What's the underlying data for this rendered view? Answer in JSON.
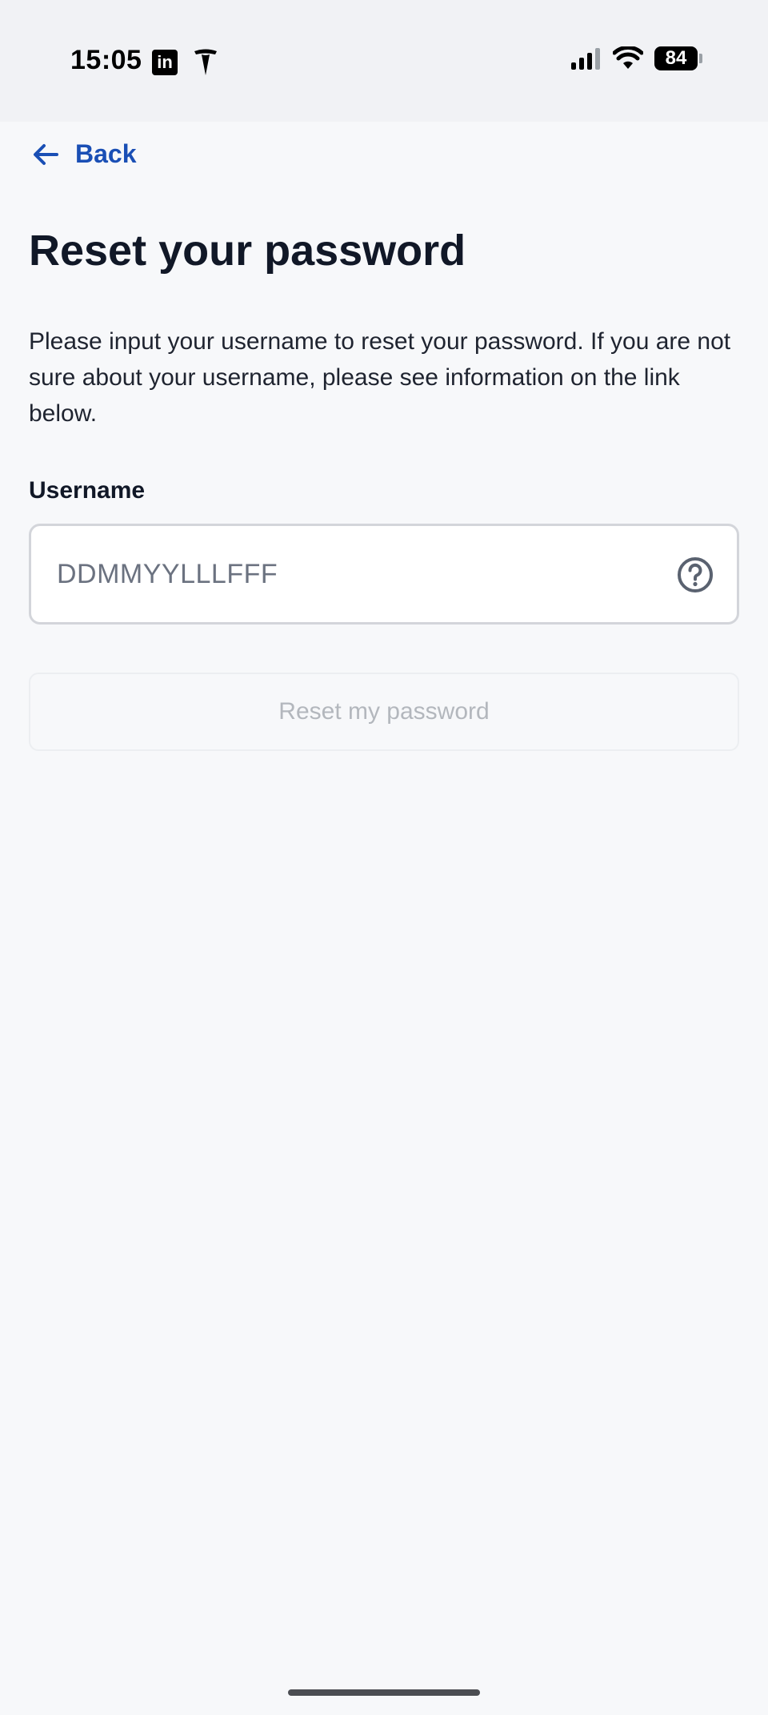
{
  "status_bar": {
    "time": "15:05",
    "app_icons": [
      "linkedin-icon",
      "tesla-icon"
    ],
    "battery_level": "84",
    "signal_icon": "cellular-signal-icon",
    "wifi_icon": "wifi-icon",
    "linkedin_letter": "in"
  },
  "nav": {
    "back_label": "Back",
    "back_icon": "arrow-left-icon"
  },
  "page": {
    "title": "Reset your password",
    "description": "Please input your username to reset your password. If you are not sure about your username, please see information on the link below."
  },
  "form": {
    "username_label": "Username",
    "username_placeholder": "DDMMYYLLLFFF",
    "username_value": "",
    "help_icon": "question-circle-icon",
    "submit_label": "Reset my password",
    "submit_enabled": false
  },
  "colors": {
    "accent": "#1a4fb5",
    "title": "#111827",
    "disabled_text": "#b3b7bd",
    "background": "#f7f8fa"
  }
}
